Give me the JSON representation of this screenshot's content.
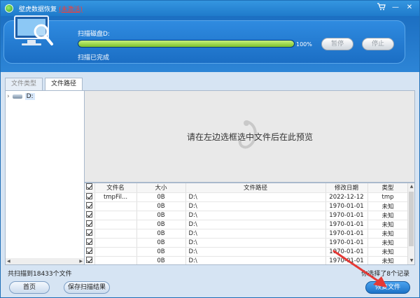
{
  "window": {
    "title": "壁虎数据恢复",
    "badge": "(未激活)"
  },
  "titlebar_icons": [
    "cart-icon",
    "minimize-icon",
    "close-icon"
  ],
  "scan": {
    "label": "扫描磁盘D:",
    "progress_percent": 100,
    "progress_text": "100%",
    "status": "扫描已完成",
    "pause_label": "暂停",
    "stop_label": "停止"
  },
  "tabs": [
    {
      "label": "文件类型",
      "active": false
    },
    {
      "label": "文件路径",
      "active": true
    }
  ],
  "tree": {
    "items": [
      {
        "label": "D:",
        "icon": "drive-icon"
      }
    ]
  },
  "preview": {
    "message": "请在左边选框选中文件后在此预览"
  },
  "table": {
    "headers": [
      "",
      "文件名",
      "大小",
      "文件路径",
      "修改日期",
      "类型"
    ],
    "rows": [
      {
        "name": "tmpFil...",
        "size": "0B",
        "path": "D:\\",
        "date": "2022-12-12",
        "type": "tmp"
      },
      {
        "name": "",
        "size": "0B",
        "path": "D:\\",
        "date": "1970-01-01",
        "type": "未知"
      },
      {
        "name": "",
        "size": "0B",
        "path": "D:\\",
        "date": "1970-01-01",
        "type": "未知"
      },
      {
        "name": "",
        "size": "0B",
        "path": "D:\\",
        "date": "1970-01-01",
        "type": "未知"
      },
      {
        "name": "",
        "size": "0B",
        "path": "D:\\",
        "date": "1970-01-01",
        "type": "未知"
      },
      {
        "name": "",
        "size": "0B",
        "path": "D:\\",
        "date": "1970-01-01",
        "type": "未知"
      },
      {
        "name": "",
        "size": "0B",
        "path": "D:\\",
        "date": "1970-01-01",
        "type": "未知"
      },
      {
        "name": "",
        "size": "0B",
        "path": "D:\\",
        "date": "1970-01-01",
        "type": "未知"
      }
    ]
  },
  "footer": {
    "found_text": "共扫描到18433个文件",
    "selected_text": "你选择了8个记录",
    "home_label": "首页",
    "save_label": "保存扫描结果",
    "recover_label": "恢复文件"
  },
  "colors": {
    "accent": "#1f7acb",
    "progress": "#7cc22c",
    "badge": "#ff3b30",
    "arrow": "#e53935"
  }
}
